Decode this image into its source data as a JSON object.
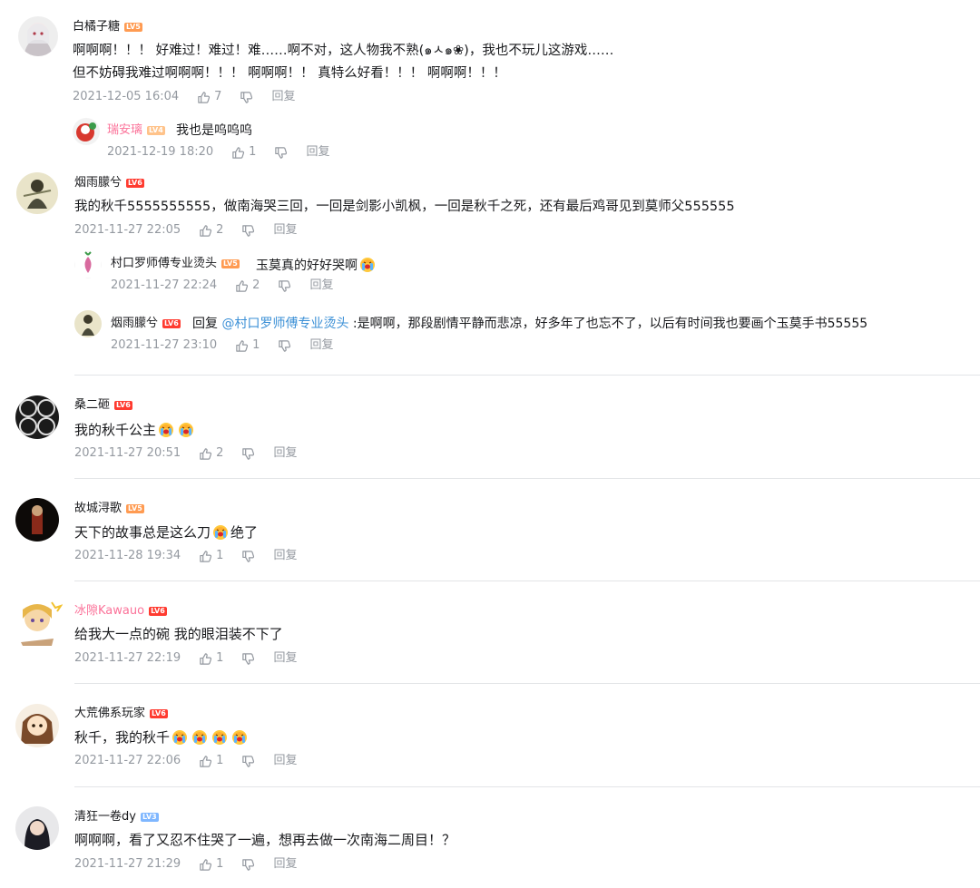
{
  "colors": {
    "lv5": "#ff9b52",
    "lv6": "#ff3b30",
    "lv3": "#7fb7ff",
    "lv4": "#ffc38a",
    "pink": "#fb7299",
    "link": "#3a8fd6",
    "meta": "#9499a0"
  },
  "comments": [
    {
      "user": "白橘子糖",
      "level": "LV5",
      "lines": [
        "啊啊啊！！！ 好难过！难过！难……啊不对，这人物我不熟(๑ㅅ๑❀)，我也不玩儿这游戏……",
        "但不妨碍我难过啊啊啊！！！ 啊啊啊！！ 真特么好看！！！ 啊啊啊！！！"
      ],
      "time": "2021-12-05 16:04",
      "likes": "7",
      "reply_label": "回复",
      "replies": [
        {
          "user": "瑞安璃",
          "level": "LV4",
          "text": "我也是呜呜呜",
          "time": "2021-12-19 18:20",
          "likes": "1",
          "reply_label": "回复"
        }
      ]
    },
    {
      "user": "烟雨朦兮",
      "level": "LV6",
      "lines": [
        "我的秋千5555555555，做南海哭三回，一回是剑影小凯枫，一回是秋千之死，还有最后鸡哥见到莫师父555555"
      ],
      "time": "2021-11-27 22:05",
      "likes": "2",
      "reply_label": "回复",
      "replies": [
        {
          "user": "村口罗师傅专业烫头",
          "level": "LV5",
          "text": "玉莫真的好好哭啊",
          "time": "2021-11-27 22:24",
          "likes": "2",
          "reply_label": "回复"
        },
        {
          "user": "烟雨朦兮",
          "level": "LV6",
          "reply_word": "回复",
          "mention": "@村口罗师傅专业烫头",
          "text": " :是啊啊，那段剧情平静而悲凉，好多年了也忘不了，以后有时间我也要画个玉莫手书55555",
          "time": "2021-11-27 23:10",
          "likes": "1",
          "reply_label": "回复"
        }
      ]
    },
    {
      "user": "桑二砸",
      "level": "LV6",
      "lines": [
        "我的秋千公主"
      ],
      "time": "2021-11-27 20:51",
      "likes": "2",
      "reply_label": "回复"
    },
    {
      "user": "故城浔歌",
      "level": "LV5",
      "lines_a": "天下的故事总是这么刀",
      "lines_b": "绝了",
      "time": "2021-11-28 19:34",
      "likes": "1",
      "reply_label": "回复"
    },
    {
      "user": "冰隙Kawauo",
      "level": "LV6",
      "lines": [
        "给我大一点的碗 我的眼泪装不下了"
      ],
      "time": "2021-11-27 22:19",
      "likes": "1",
      "reply_label": "回复"
    },
    {
      "user": "大荒佛系玩家",
      "level": "LV6",
      "lines": [
        "秋千，我的秋千"
      ],
      "time": "2021-11-27 22:06",
      "likes": "1",
      "reply_label": "回复"
    },
    {
      "user": "清狂一卷dy",
      "level": "LV3",
      "lines": [
        "啊啊啊，看了又忍不住哭了一遍，想再去做一次南海二周目！？"
      ],
      "time": "2021-11-27 21:29",
      "likes": "1",
      "reply_label": "回复"
    }
  ]
}
